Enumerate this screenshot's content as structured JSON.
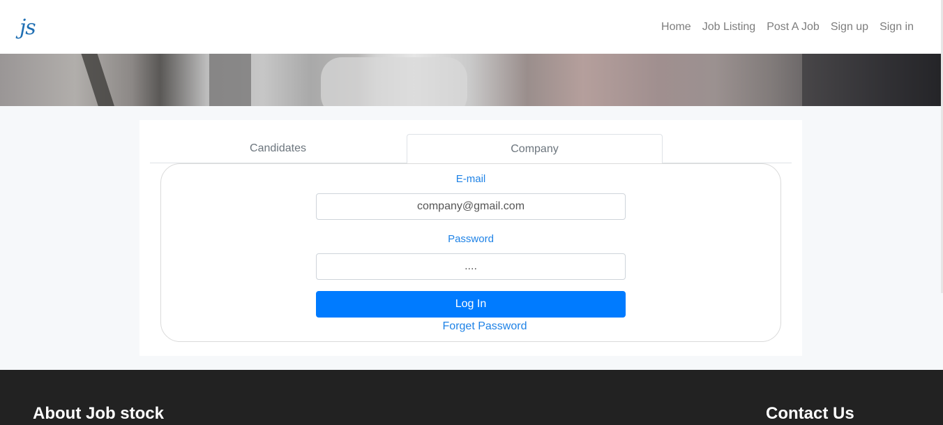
{
  "brand": {
    "logo_text": "js"
  },
  "nav": {
    "items": [
      {
        "label": "Home"
      },
      {
        "label": "Job Listing"
      },
      {
        "label": "Post A Job"
      },
      {
        "label": "Sign up"
      },
      {
        "label": "Sign in"
      }
    ]
  },
  "login": {
    "tabs": [
      {
        "label": "Candidates",
        "active": false
      },
      {
        "label": "Company",
        "active": true
      }
    ],
    "email_label": "E-mail",
    "email_value": "company@gmail.com",
    "password_label": "Password",
    "password_value": "....",
    "login_button": "Log In",
    "forget_link": "Forget Password"
  },
  "footer": {
    "about_title": "About Job stock",
    "contact_title": "Contact Us"
  },
  "colors": {
    "accent": "#007bff",
    "label_blue": "#1e82e6",
    "footer_bg": "#222222"
  }
}
